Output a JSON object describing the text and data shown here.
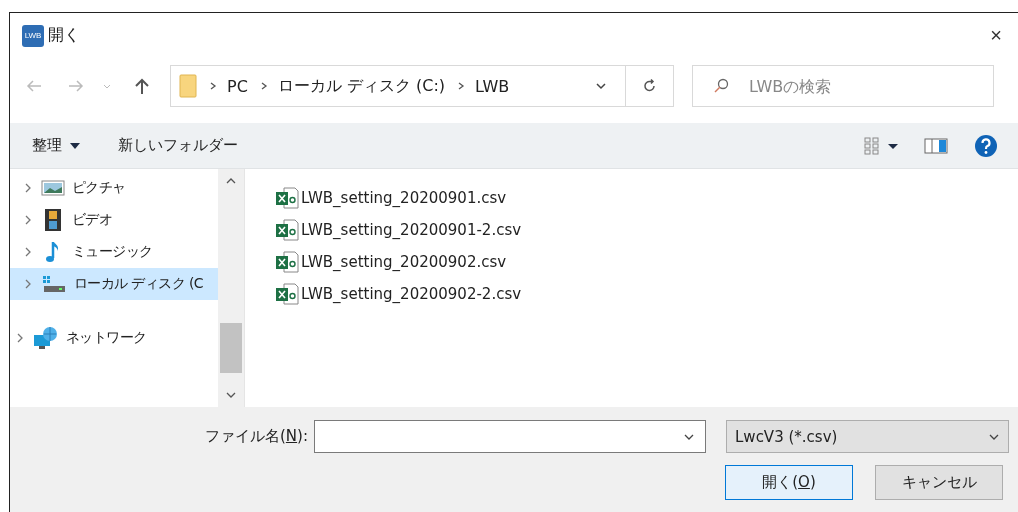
{
  "window": {
    "title": "開く",
    "app_icon_text": "LWB",
    "close": "×"
  },
  "address_bar": {
    "path": [
      "PC",
      "ローカル ディスク (C:)",
      "LWB"
    ]
  },
  "search": {
    "placeholder": "LWBの検索"
  },
  "toolbar": {
    "organize": "整理",
    "new_folder": "新しいフォルダー"
  },
  "sidebar": {
    "pc_children": [
      {
        "label": "ピクチャ",
        "kind": "pictures",
        "selected": false
      },
      {
        "label": "ビデオ",
        "kind": "videos",
        "selected": false
      },
      {
        "label": "ミュージック",
        "kind": "music",
        "selected": false
      },
      {
        "label": "ローカル ディスク (C",
        "kind": "disk",
        "selected": true
      }
    ],
    "network": {
      "label": "ネットワーク",
      "selected": false
    }
  },
  "files": [
    {
      "name": "LWB_setting_20200901.csv"
    },
    {
      "name": "LWB_setting_20200901-2.csv"
    },
    {
      "name": "LWB_setting_20200902.csv"
    },
    {
      "name": "LWB_setting_20200902-2.csv"
    }
  ],
  "filename": {
    "label_before": "ファイル名(",
    "label_key": "N",
    "label_after": "):"
  },
  "filetype": {
    "value": "LwcV3 (*.csv)"
  },
  "buttons": {
    "open": {
      "before": "開く(",
      "key": "O",
      "after": ")",
      "default": true
    },
    "cancel": {
      "label": "キャンセル"
    }
  }
}
